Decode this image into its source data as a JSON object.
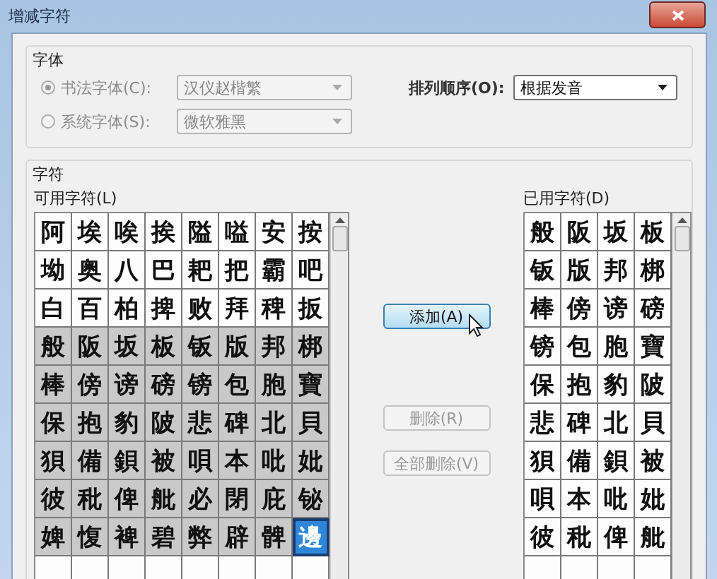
{
  "window": {
    "title": "增减字符"
  },
  "font_group": {
    "label": "字体",
    "options": [
      {
        "label": "书法字体(C):",
        "selected": true,
        "value": "汉仪赵楷繁",
        "disabled": true
      },
      {
        "label": "系统字体(S):",
        "selected": false,
        "value": "微软雅黑",
        "disabled": true
      }
    ],
    "sort": {
      "label": "排列顺序(O):",
      "value": "根据发音"
    }
  },
  "chars_group": {
    "label": "字符",
    "available": {
      "label": "可用字符(L)",
      "rows": [
        {
          "used": false,
          "cells": [
            {
              "text": "阿",
              "selected": false
            },
            {
              "text": "埃",
              "selected": false
            },
            {
              "text": "唉",
              "selected": false
            },
            {
              "text": "挨",
              "selected": false
            },
            {
              "text": "隘",
              "selected": false
            },
            {
              "text": "嗌",
              "selected": false
            },
            {
              "text": "安",
              "selected": false
            },
            {
              "text": "按",
              "selected": false
            }
          ]
        },
        {
          "used": false,
          "cells": [
            {
              "text": "坳",
              "selected": false
            },
            {
              "text": "奥",
              "selected": false
            },
            {
              "text": "八",
              "selected": false
            },
            {
              "text": "巴",
              "selected": false
            },
            {
              "text": "耙",
              "selected": false
            },
            {
              "text": "把",
              "selected": false
            },
            {
              "text": "霸",
              "selected": false
            },
            {
              "text": "吧",
              "selected": false
            }
          ]
        },
        {
          "used": false,
          "cells": [
            {
              "text": "白",
              "selected": false
            },
            {
              "text": "百",
              "selected": false
            },
            {
              "text": "柏",
              "selected": false
            },
            {
              "text": "捭",
              "selected": false
            },
            {
              "text": "败",
              "selected": false
            },
            {
              "text": "拜",
              "selected": false
            },
            {
              "text": "稗",
              "selected": false
            },
            {
              "text": "扳",
              "selected": false
            }
          ]
        },
        {
          "used": true,
          "cells": [
            {
              "text": "般",
              "selected": false
            },
            {
              "text": "阪",
              "selected": false
            },
            {
              "text": "坂",
              "selected": false
            },
            {
              "text": "板",
              "selected": false
            },
            {
              "text": "钣",
              "selected": false
            },
            {
              "text": "版",
              "selected": false
            },
            {
              "text": "邦",
              "selected": false
            },
            {
              "text": "梆",
              "selected": false
            }
          ]
        },
        {
          "used": true,
          "cells": [
            {
              "text": "棒",
              "selected": false
            },
            {
              "text": "傍",
              "selected": false
            },
            {
              "text": "谤",
              "selected": false
            },
            {
              "text": "磅",
              "selected": false
            },
            {
              "text": "镑",
              "selected": false
            },
            {
              "text": "包",
              "selected": false
            },
            {
              "text": "胞",
              "selected": false
            },
            {
              "text": "寶",
              "selected": false
            }
          ]
        },
        {
          "used": true,
          "cells": [
            {
              "text": "保",
              "selected": false
            },
            {
              "text": "抱",
              "selected": false
            },
            {
              "text": "豹",
              "selected": false
            },
            {
              "text": "陂",
              "selected": false
            },
            {
              "text": "悲",
              "selected": false
            },
            {
              "text": "碑",
              "selected": false
            },
            {
              "text": "北",
              "selected": false
            },
            {
              "text": "貝",
              "selected": false
            }
          ]
        },
        {
          "used": true,
          "cells": [
            {
              "text": "狽",
              "selected": false
            },
            {
              "text": "備",
              "selected": false
            },
            {
              "text": "鋇",
              "selected": false
            },
            {
              "text": "被",
              "selected": false
            },
            {
              "text": "唄",
              "selected": false
            },
            {
              "text": "本",
              "selected": false
            },
            {
              "text": "吡",
              "selected": false
            },
            {
              "text": "妣",
              "selected": false
            }
          ]
        },
        {
          "used": true,
          "cells": [
            {
              "text": "彼",
              "selected": false
            },
            {
              "text": "秕",
              "selected": false
            },
            {
              "text": "俾",
              "selected": false
            },
            {
              "text": "舭",
              "selected": false
            },
            {
              "text": "必",
              "selected": false
            },
            {
              "text": "閉",
              "selected": false
            },
            {
              "text": "庇",
              "selected": false
            },
            {
              "text": "铋",
              "selected": false
            }
          ]
        },
        {
          "used": true,
          "cells": [
            {
              "text": "婢",
              "selected": false
            },
            {
              "text": "愎",
              "selected": false
            },
            {
              "text": "裨",
              "selected": false
            },
            {
              "text": "碧",
              "selected": false
            },
            {
              "text": "弊",
              "selected": false
            },
            {
              "text": "辟",
              "selected": false
            },
            {
              "text": "髀",
              "selected": false
            },
            {
              "text": "邊",
              "selected": true
            }
          ]
        }
      ]
    },
    "buttons": [
      {
        "label": "添加(A)",
        "disabled": false
      },
      {
        "label": "删除(R)",
        "disabled": true
      },
      {
        "label": "全部删除(V)",
        "disabled": true
      }
    ],
    "used_chars": {
      "label": "已用字符(D)",
      "rows": [
        [
          "般",
          "阪",
          "坂",
          "板"
        ],
        [
          "钣",
          "版",
          "邦",
          "梆"
        ],
        [
          "棒",
          "傍",
          "谤",
          "磅"
        ],
        [
          "镑",
          "包",
          "胞",
          "寶"
        ],
        [
          "保",
          "抱",
          "豹",
          "陂"
        ],
        [
          "悲",
          "碑",
          "北",
          "貝"
        ],
        [
          "狽",
          "備",
          "鋇",
          "被"
        ],
        [
          "唄",
          "本",
          "吡",
          "妣"
        ],
        [
          "彼",
          "秕",
          "俾",
          "舭"
        ]
      ]
    }
  }
}
